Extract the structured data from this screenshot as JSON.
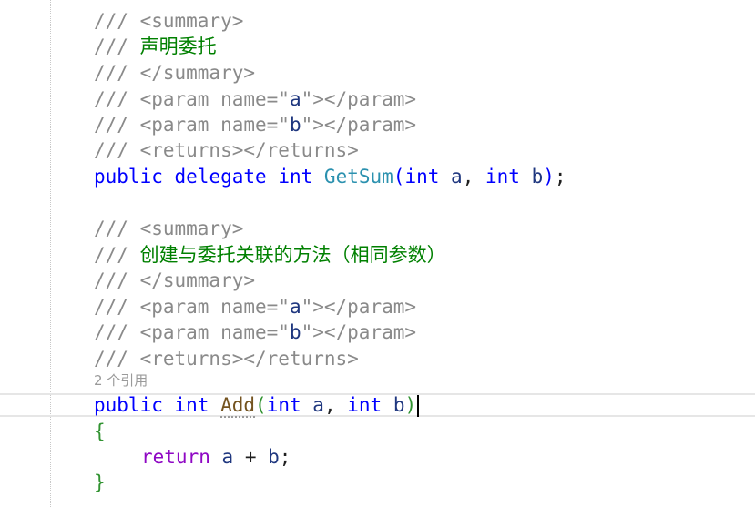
{
  "block1": {
    "summary_open": "/// <summary>",
    "comment_prefix": "/// ",
    "comment_text": "声明委托",
    "summary_close": "/// </summary>",
    "param_a": {
      "prefix": "/// <param name=\"",
      "name": "a",
      "suffix": "\"></param>"
    },
    "param_b": {
      "prefix": "/// <param name=\"",
      "name": "b",
      "suffix": "\"></param>"
    },
    "returns": "/// <returns></returns>",
    "decl": {
      "kw_public": "public",
      "kw_delegate": "delegate",
      "kw_int": "int",
      "name": "GetSum",
      "open_paren": "(",
      "p1_type": "int",
      "p1_name": "a",
      "comma": ", ",
      "p2_type": "int",
      "p2_name": "b",
      "close_paren": ")",
      "semicolon": ";"
    }
  },
  "block2": {
    "summary_open": "/// <summary>",
    "comment_prefix": "/// ",
    "comment_text": "创建与委托关联的方法（相同参数）",
    "summary_close": "/// </summary>",
    "param_a": {
      "prefix": "/// <param name=\"",
      "name": "a",
      "suffix": "\"></param>"
    },
    "param_b": {
      "prefix": "/// <param name=\"",
      "name": "b",
      "suffix": "\"></param>"
    },
    "returns": "/// <returns></returns>",
    "references": "2 个引用",
    "decl": {
      "kw_public": "public",
      "kw_int": "int",
      "name": "Add",
      "open_paren": "(",
      "p1_type": "int",
      "p1_name": "a",
      "comma": ", ",
      "p2_type": "int",
      "p2_name": "b",
      "close_paren": ")"
    },
    "open_brace": "{",
    "body": {
      "kw_return": "return",
      "expr_a": "a",
      "op": " + ",
      "expr_b": "b",
      "semicolon": ";"
    },
    "close_brace": "}"
  }
}
